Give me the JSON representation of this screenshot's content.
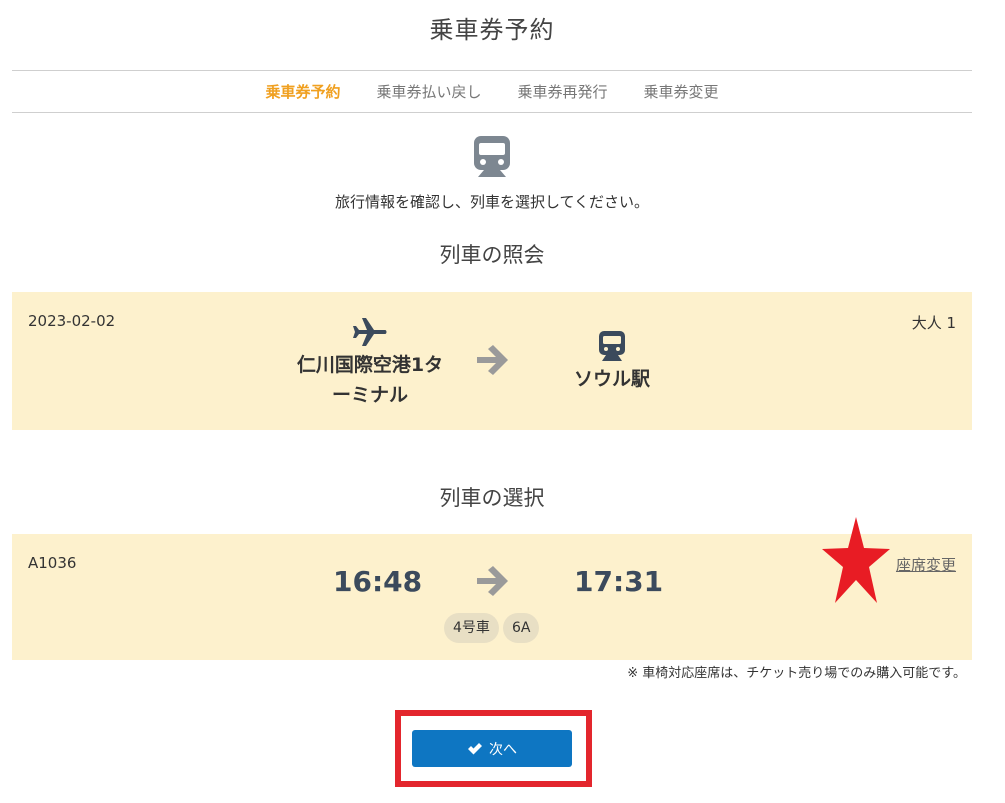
{
  "page": {
    "title": "乗車券予約"
  },
  "tabs": [
    {
      "label": "乗車券予約",
      "active": true
    },
    {
      "label": "乗車券払い戻し",
      "active": false
    },
    {
      "label": "乗車券再発行",
      "active": false
    },
    {
      "label": "乗車券変更",
      "active": false
    }
  ],
  "instruction": "旅行情報を確認し、列車を選択してください。",
  "inquiry": {
    "section_title": "列車の照会",
    "date": "2023-02-02",
    "passengers": "大人 1",
    "origin": {
      "name_line1": "仁川国際空港1タ",
      "name_line2": "ーミナル",
      "icon": "airplane-icon"
    },
    "destination": {
      "name": "ソウル駅",
      "icon": "train-icon"
    }
  },
  "selection": {
    "section_title": "列車の選択",
    "train_number": "A1036",
    "departure_time": "16:48",
    "arrival_time": "17:31",
    "car": "4号車",
    "seat": "6A",
    "seat_change_label": "座席変更"
  },
  "note": "※ 車椅対応座席は、チケット売り場でのみ購入可能です。",
  "next_button": {
    "label": "次へ",
    "icon": "check-icon"
  },
  "colors": {
    "active_tab": "#f0a020",
    "panel_bg": "#fdf1cd",
    "button_bg": "#0e76c2",
    "highlight_red": "#e3262d",
    "star_red": "#e81c24"
  }
}
